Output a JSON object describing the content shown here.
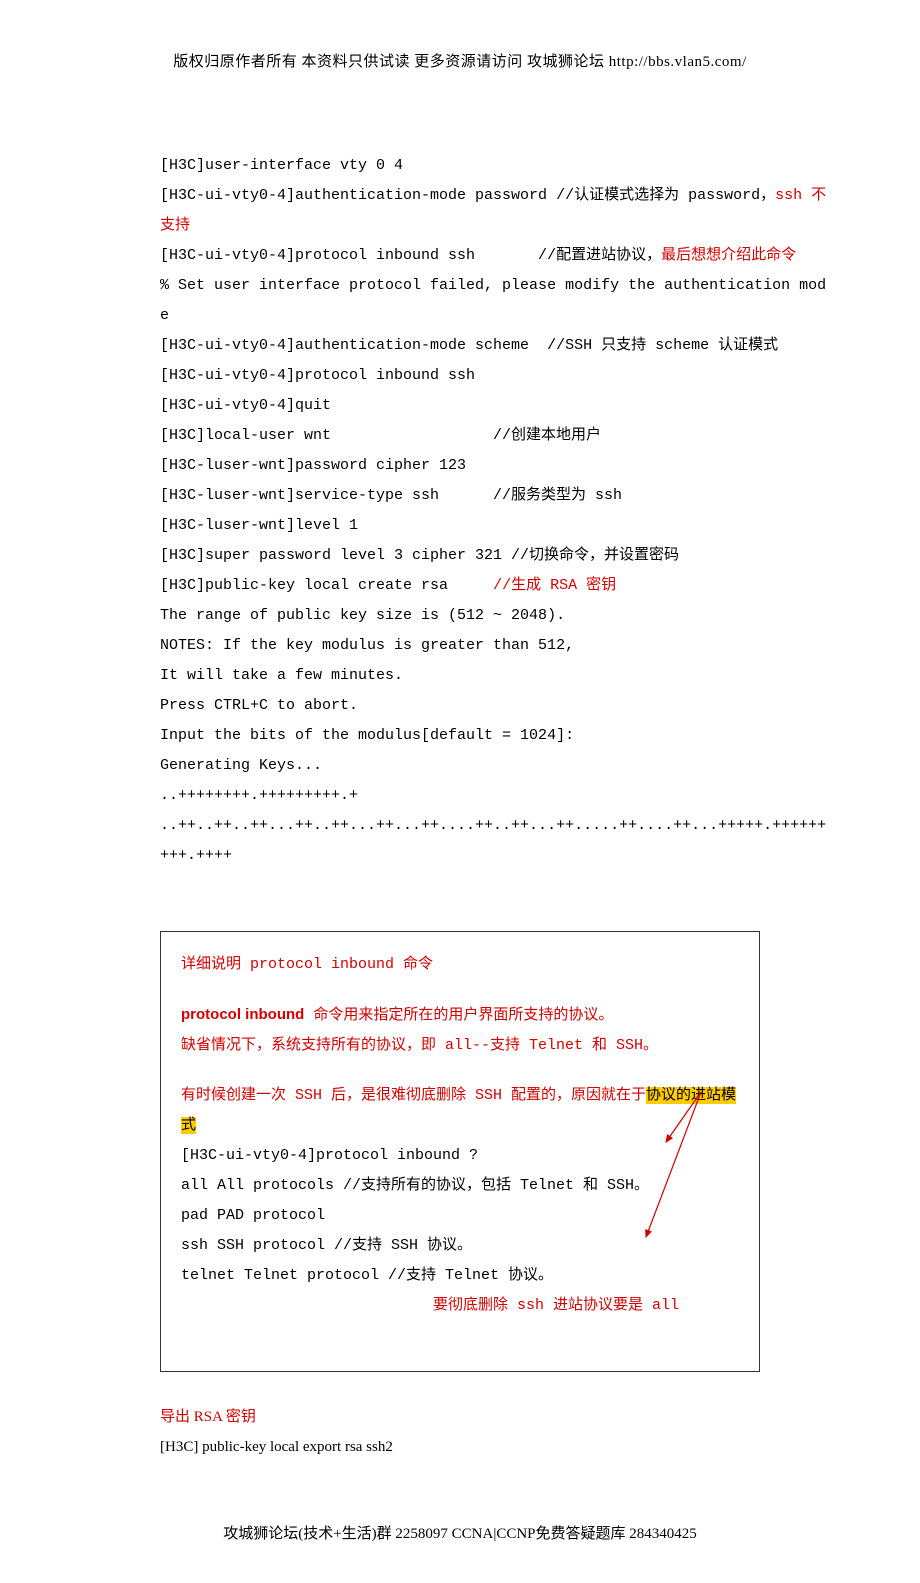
{
  "header": "版权归原作者所有 本资料只供试读 更多资源请访问 攻城狮论坛 http://bbs.vlan5.com/",
  "footer": "攻城狮论坛(技术+生活)群 2258097 CCNA|CCNP免费答疑题库 284340425",
  "code": {
    "l1": "[H3C]user-interface vty 0 4",
    "l2a": "[H3C-ui-vty0-4]authentication-mode password //认证模式选择为 password，",
    "l2b": "ssh 不支持",
    "l3a": "[H3C-ui-vty0-4]protocol inbound ssh       //配置进站协议，",
    "l3b": "最后想想介绍此命令",
    "l4": "% Set user interface protocol failed, please modify the authentication mode",
    "l5": "[H3C-ui-vty0-4]authentication-mode scheme  //SSH 只支持 scheme 认证模式",
    "l6": "[H3C-ui-vty0-4]protocol inbound ssh",
    "l7": "[H3C-ui-vty0-4]quit",
    "l8": "[H3C]local-user wnt                  //创建本地用户",
    "l9": "[H3C-luser-wnt]password cipher 123",
    "l10": "[H3C-luser-wnt]service-type ssh      //服务类型为 ssh",
    "l11": "[H3C-luser-wnt]level 1",
    "l12": "[H3C]super password level 3 cipher 321 //切换命令，并设置密码",
    "l13a": "[H3C]public-key local create rsa     ",
    "l13b": "//生成 RSA 密钥",
    "l14": "The range of public key size is (512 ~ 2048).",
    "l15": "NOTES: If the key modulus is greater than 512,",
    "l16": "It will take a few minutes.",
    "l17": "Press CTRL+C to abort.",
    "l18": "Input the bits of the modulus[default = 1024]:",
    "l19": "Generating Keys...",
    "l20": "..++++++++.+++++++++.+",
    "l21": "..++..++..++...++..++...++...++....++..++...++.....++....++...+++++.+++++++++.++++"
  },
  "box": {
    "title": "详细说明 protocol inbound 命令",
    "p1a": "protocol inbound",
    "p1b": " 命令用来指定所在的用户界面所支持的协议。",
    "p2": "缺省情况下，系统支持所有的协议，即 all--支持 Telnet 和 SSH。",
    "p3a": "有时候创建一次 SSH 后，是很难彻底删除 SSH 配置的，原因就在于",
    "p3b": "协议的进站模式",
    "cmd": "[H3C-ui-vty0-4]protocol inbound ?",
    "opt1": "  all    All protocols         //支持所有的协议，包括 Telnet 和 SSH。",
    "opt2": "  pad    PAD protocol",
    "opt3": "  ssh    SSH protocol          //支持 SSH 协议。",
    "opt4": "  telnet Telnet protocol       //支持 Telnet 协议。",
    "note": "要彻底删除 ssh 进站协议要是 all"
  },
  "section2": {
    "title": "导出 RSA 密钥",
    "cmd": "[H3C] public-key local export rsa ssh2"
  }
}
